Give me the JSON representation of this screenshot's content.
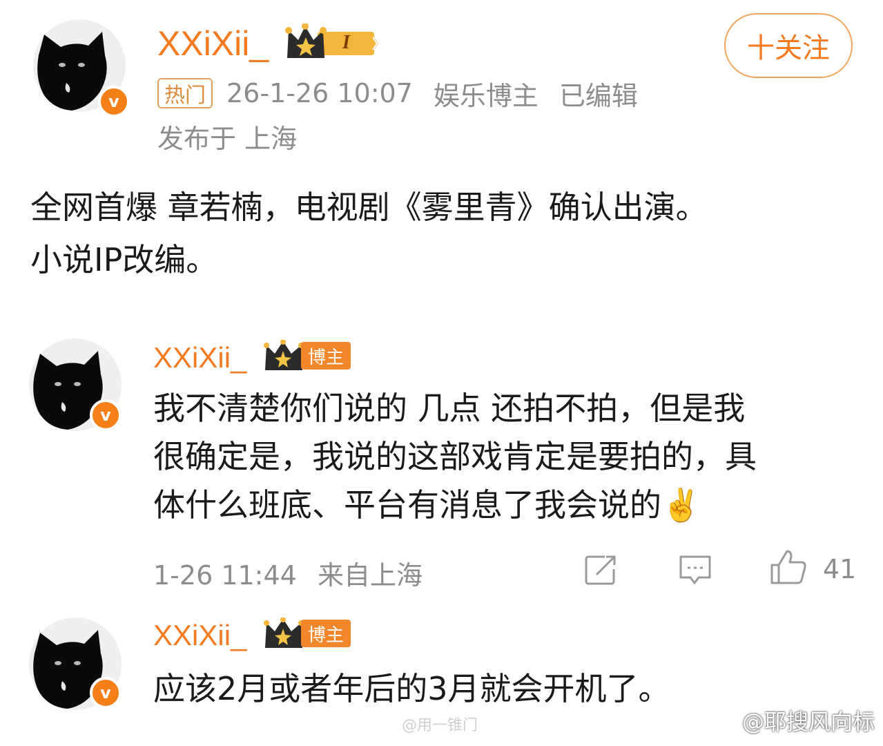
{
  "post": {
    "username": "XXiXii_",
    "level_badge": "I",
    "follow_label": "十关注",
    "hot_tag": "热门",
    "timestamp": "26-1-26 10:07",
    "category": "娱乐博主",
    "edited": "已编辑",
    "location": "发布于 上海",
    "body_lines": [
      "全网首爆  章若楠，电视剧《雾里青》确认出演。",
      "小说IP改编。"
    ]
  },
  "comments": [
    {
      "username": "XXiXii_",
      "badge_label": "博主",
      "text_lines": [
        "我不清楚你们说的 几点  还拍不拍，但是我",
        "很确定是，我说的这部戏肯定是要拍的，具",
        "体什么班底、平台有消息了我会说的✌️"
      ],
      "timestamp": "1-26 11:44",
      "location": "来自上海",
      "likes": "41"
    },
    {
      "username": "XXiXii_",
      "badge_label": "博主",
      "text_lines": [
        "应该2月或者年后的3月就会开机了。"
      ]
    }
  ],
  "watermarks": {
    "right": "@耶搜风向标",
    "center": "@用一锥门"
  },
  "icons": {
    "verified": "v",
    "share": "share-icon",
    "comment": "comment-icon",
    "like": "thumbs-up-icon",
    "crown": "crown-icon"
  },
  "colors": {
    "accent": "#f47a1f",
    "muted_text": "#8c8c8c",
    "verified_badge": "#f57f17"
  }
}
